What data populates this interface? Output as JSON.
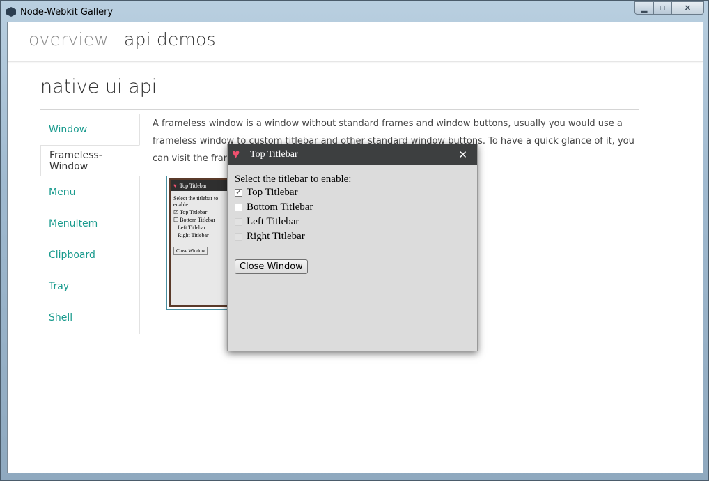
{
  "window": {
    "title": "Node-Webkit Gallery",
    "minimize": "▁",
    "maximize": "□",
    "close": "✕"
  },
  "topnav": {
    "items": [
      "overview",
      "api demos"
    ]
  },
  "page": {
    "title": "native ui api"
  },
  "sidebar": {
    "items": [
      "Window",
      "Frameless-Window",
      "Menu",
      "MenuItem",
      "Clipboard",
      "Tray",
      "Shell"
    ],
    "active": "Frameless-Window"
  },
  "content": {
    "text": "A frameless window is a window without standard frames and window buttons, usually you would use a frameless window to custom titlebar and other standard window buttons. To have a quick glance of it, you can visit the frameless-window"
  },
  "thumbnail": {
    "title": "Top Titlebar",
    "prompt": "Select the titlebar to enable:",
    "options": [
      "Top Titlebar",
      "Bottom Titlebar",
      "Left Titlebar",
      "Right Titlebar"
    ],
    "button": "Close Window"
  },
  "frameless_window": {
    "title": "Top Titlebar",
    "close": "✕",
    "prompt": "Select the titlebar to enable:",
    "options": [
      {
        "label": "Top Titlebar",
        "checked": true,
        "enabled": true
      },
      {
        "label": "Bottom Titlebar",
        "checked": false,
        "enabled": true
      },
      {
        "label": "Left Titlebar",
        "checked": false,
        "enabled": false
      },
      {
        "label": "Right Titlebar",
        "checked": false,
        "enabled": false
      }
    ],
    "button": "Close Window"
  },
  "colors": {
    "accent": "#1a9b8e",
    "titlebar": "#3d3f40",
    "heart": "#f0506e"
  }
}
